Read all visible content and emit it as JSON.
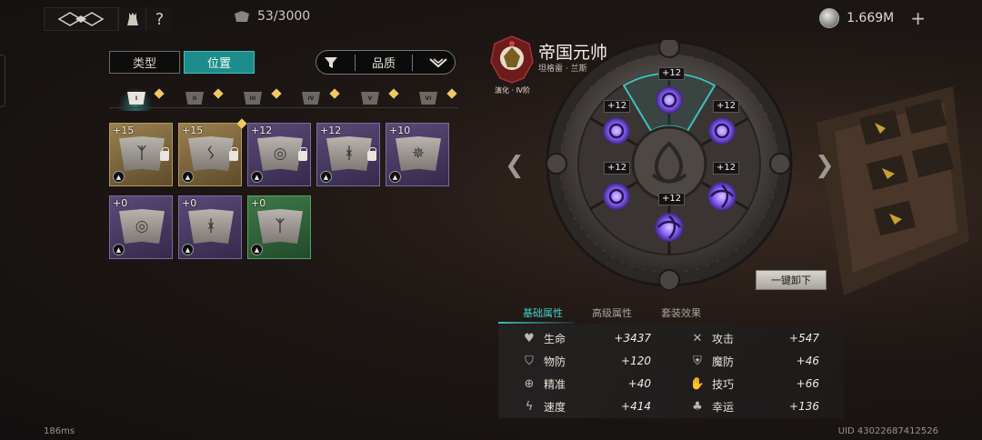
{
  "topbar": {
    "capacity": "53/3000",
    "currency": "1.669M",
    "help_label": "?"
  },
  "tabs": [
    {
      "label": "类型",
      "active": false
    },
    {
      "label": "位置",
      "active": true
    }
  ],
  "filter": {
    "label": "品质"
  },
  "slot_positions": [
    "I",
    "II",
    "III",
    "IV",
    "V",
    "VI"
  ],
  "runes": [
    {
      "level": "+15",
      "quality": "gold",
      "glyph": "ᛉ",
      "locked": true
    },
    {
      "level": "+15",
      "quality": "gold",
      "glyph": "ᛊ",
      "locked": true
    },
    {
      "level": "+12",
      "quality": "purple",
      "glyph": "◎",
      "locked": true
    },
    {
      "level": "+12",
      "quality": "purple",
      "glyph": "ᚼ",
      "locked": true
    },
    {
      "level": "+10",
      "quality": "purple",
      "glyph": "✵",
      "locked": false
    },
    {
      "level": "+0",
      "quality": "purple",
      "glyph": "◎",
      "locked": false
    },
    {
      "level": "+0",
      "quality": "purple",
      "glyph": "ᚼ",
      "locked": false
    },
    {
      "level": "+0",
      "quality": "green",
      "glyph": "ᛉ",
      "locked": false
    }
  ],
  "character": {
    "name": "帝国元帅",
    "subtitle": "坦格雷 · 兰斯",
    "rank": "演化 · Ⅳ阶"
  },
  "wheel": {
    "plus_labels": [
      "+12",
      "+12",
      "+12",
      "+12",
      "+12",
      "+12"
    ],
    "unequip_label": "一键卸下"
  },
  "stat_tabs": [
    "基础属性",
    "高级属性",
    "套装效果"
  ],
  "stats_left": [
    {
      "label": "生命",
      "value": "+3437",
      "icon": "heart-icon"
    },
    {
      "label": "物防",
      "value": "+120",
      "icon": "shield-icon"
    },
    {
      "label": "精准",
      "value": "+40",
      "icon": "crosshair-icon"
    },
    {
      "label": "速度",
      "value": "+414",
      "icon": "lightning-icon"
    }
  ],
  "stats_right": [
    {
      "label": "攻击",
      "value": "+547",
      "icon": "swords-icon"
    },
    {
      "label": "魔防",
      "value": "+46",
      "icon": "magic-shield-icon"
    },
    {
      "label": "技巧",
      "value": "+66",
      "icon": "skill-icon"
    },
    {
      "label": "幸运",
      "value": "+136",
      "icon": "clover-icon"
    }
  ],
  "footer": {
    "latency": "186ms",
    "uid": "UID 43022687412526"
  },
  "colors": {
    "accent": "#1c8d8a",
    "rune_glow": "#8a60ff",
    "gold": "#f0c866"
  }
}
